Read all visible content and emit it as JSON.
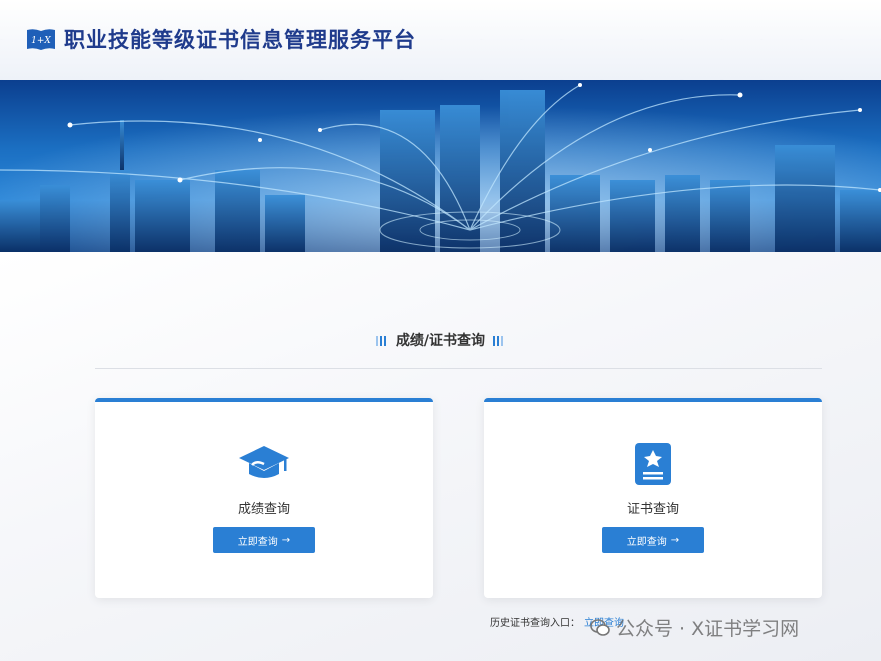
{
  "header": {
    "title": "职业技能等级证书信息管理服务平台",
    "logo_text": "1+X"
  },
  "section": {
    "title": "成绩/证书查询"
  },
  "cards": [
    {
      "label": "成绩查询",
      "button": "立即查询",
      "icon": "graduation-cap-icon"
    },
    {
      "label": "证书查询",
      "button": "立即查询",
      "icon": "certificate-icon"
    }
  ],
  "history": {
    "label": "历史证书查询入口：",
    "link": "立即查询"
  },
  "watermark": {
    "text": "公众号 · X证书学习网"
  },
  "colors": {
    "brand_blue": "#2a7fd4",
    "title_blue": "#1f3b8c"
  }
}
